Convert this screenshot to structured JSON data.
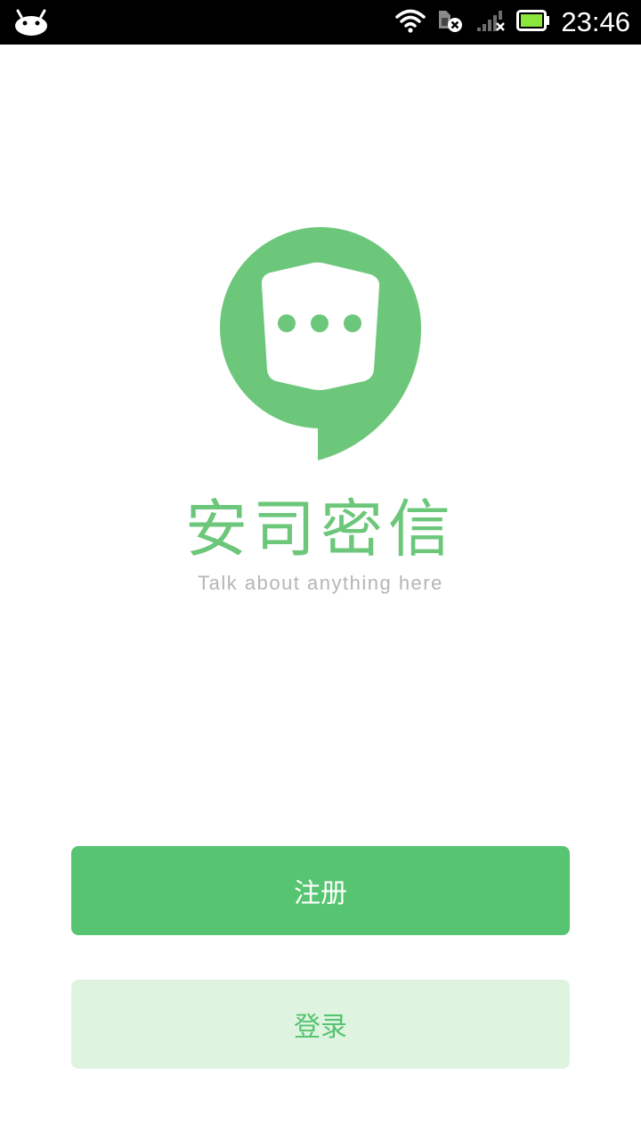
{
  "status_bar": {
    "time": "23:46",
    "icons": [
      "android-icon",
      "wifi-icon",
      "sim-disabled-icon",
      "signal-off-icon",
      "battery-icon"
    ]
  },
  "app": {
    "name": "安司密信",
    "tagline": "Talk about anything here",
    "brand_color": "#6cc77a"
  },
  "actions": {
    "register_label": "注册",
    "login_label": "登录",
    "register_color": "#56c471",
    "login_background": "#dff4e0"
  }
}
